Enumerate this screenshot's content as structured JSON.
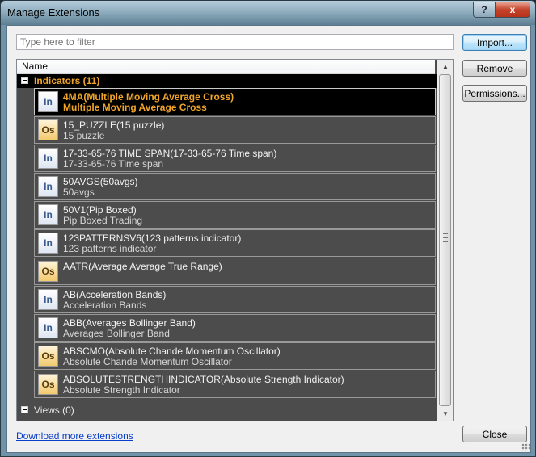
{
  "window": {
    "title": "Manage Extensions",
    "help_label": "?",
    "close_label": "x"
  },
  "filter": {
    "placeholder": "Type here to filter",
    "value": ""
  },
  "buttons": {
    "import": "Import...",
    "remove": "Remove",
    "permissions": "Permissions...",
    "close": "Close"
  },
  "list": {
    "column_header": "Name",
    "groups": [
      {
        "label": "Indicators (11)",
        "expanded": true,
        "items": [
          {
            "icon": "In",
            "title": "4MA(Multiple Moving Average Cross)",
            "subtitle": "Multiple Moving Average Cross",
            "selected": true
          },
          {
            "icon": "Os",
            "title": "15_PUZZLE(15 puzzle)",
            "subtitle": "15 puzzle"
          },
          {
            "icon": "In",
            "title": "17-33-65-76 TIME SPAN(17-33-65-76 Time span)",
            "subtitle": "17-33-65-76 Time span"
          },
          {
            "icon": "In",
            "title": "50AVGS(50avgs)",
            "subtitle": "50avgs"
          },
          {
            "icon": "In",
            "title": "50V1(Pip Boxed)",
            "subtitle": "Pip Boxed Trading"
          },
          {
            "icon": "In",
            "title": "123PATTERNSV6(123 patterns indicator)",
            "subtitle": "123 patterns indicator"
          },
          {
            "icon": "Os",
            "title": "AATR(Average Average True Range)",
            "subtitle": ""
          },
          {
            "icon": "In",
            "title": "AB(Acceleration Bands)",
            "subtitle": "Acceleration Bands"
          },
          {
            "icon": "In",
            "title": "ABB(Averages Bollinger Band)",
            "subtitle": "Averages Bollinger Band"
          },
          {
            "icon": "Os",
            "title": "ABSCMO(Absolute Chande Momentum Oscillator)",
            "subtitle": "Absolute Chande Momentum Oscillator"
          },
          {
            "icon": "Os",
            "title": "ABSOLUTESTRENGTHINDICATOR(Absolute Strength Indicator)",
            "subtitle": "Absolute Strength Indicator"
          }
        ]
      },
      {
        "label": "Views (0)",
        "expanded": true,
        "items": []
      }
    ]
  },
  "download_link": "Download more extensions",
  "colors": {
    "accent_orange": "#f0a52a",
    "list_bg": "#4c4c4c",
    "link_blue": "#0a3ecb"
  }
}
